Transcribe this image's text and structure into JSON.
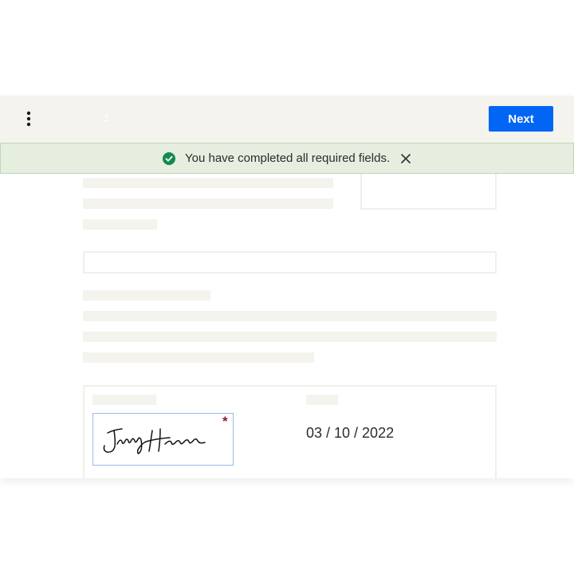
{
  "topbar": {
    "menu_icon": "more-vertical-icon",
    "page_indicator": "1",
    "next_label": "Next",
    "next_color": "#0265f4"
  },
  "toast": {
    "status_icon": "check-circle-icon",
    "message": "You have completed all required fields.",
    "close_icon": "close-icon",
    "background": "#e6eedf",
    "check_color": "#138a4e"
  },
  "signature_block": {
    "signature_image": "handwritten-signature",
    "signature_text": "Jenny Hansen",
    "required_marker": "*",
    "date": "03 / 10 / 2022"
  }
}
